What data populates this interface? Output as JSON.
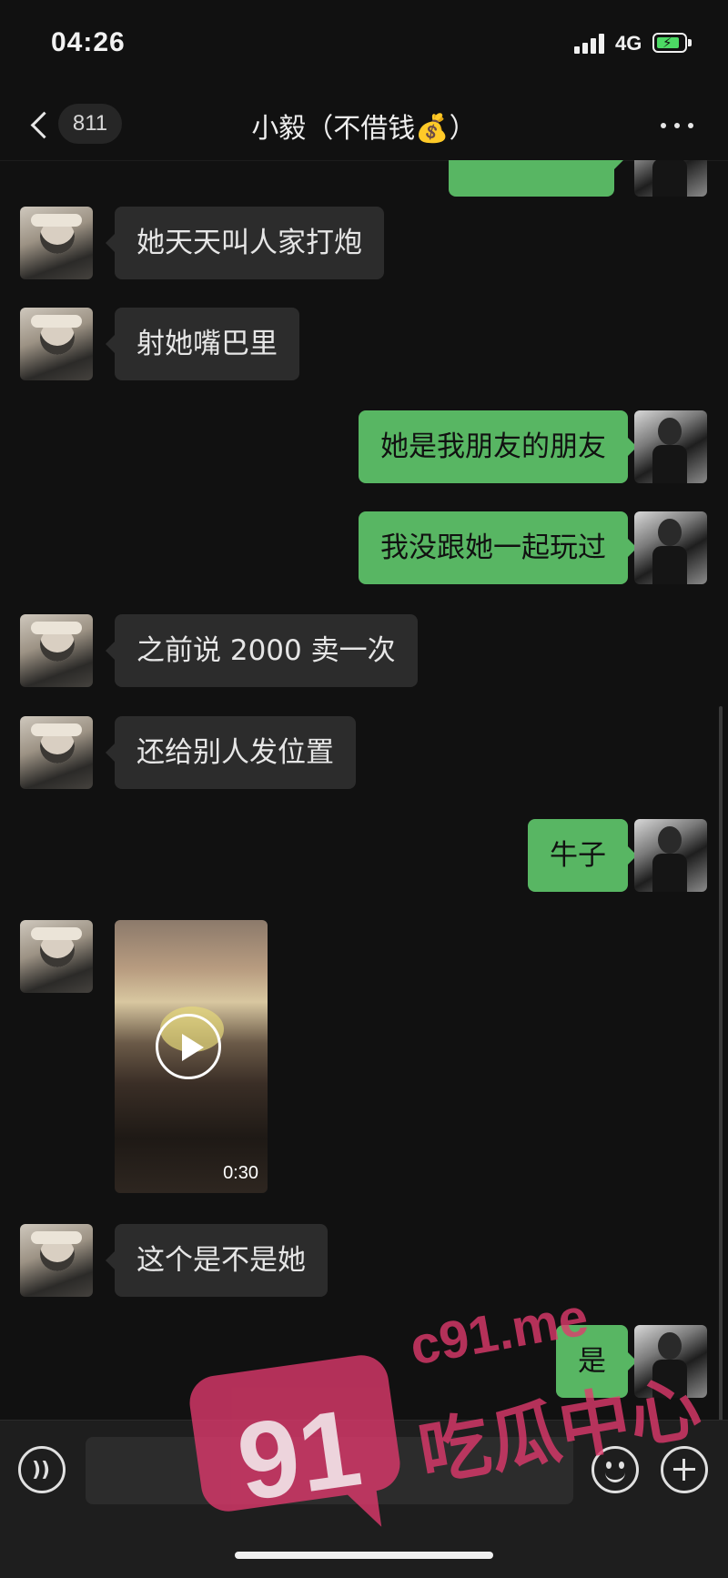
{
  "status_bar": {
    "time": "04:26",
    "network": "4G"
  },
  "header": {
    "unread_count": "811",
    "title": "小毅（不借钱💰）"
  },
  "messages": [
    {
      "from": "other",
      "text": "她天天叫人家打炮"
    },
    {
      "from": "other",
      "text": "射她嘴巴里"
    },
    {
      "from": "me",
      "text": "她是我朋友的朋友"
    },
    {
      "from": "me",
      "text": "我没跟她一起玩过"
    },
    {
      "from": "other",
      "text": "之前说 2000 卖一次"
    },
    {
      "from": "other",
      "text": "还给别人发位置"
    },
    {
      "from": "me",
      "text": "牛子"
    },
    {
      "from": "other",
      "type": "video",
      "duration": "0:30"
    },
    {
      "from": "other",
      "text": "这个是不是她"
    },
    {
      "from": "me",
      "text": "是"
    }
  ],
  "watermark": {
    "number": "91",
    "url": "c91.me",
    "name": "吃瓜中心"
  },
  "colors": {
    "background": "#111111",
    "incoming_bubble": "#2c2c2c",
    "outgoing_bubble": "#58b663",
    "watermark": "#e23a6e"
  }
}
